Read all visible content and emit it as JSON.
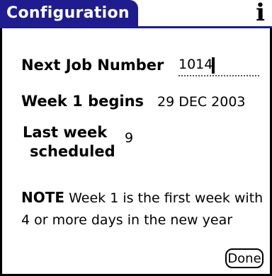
{
  "titlebar": {
    "title": "Configuration",
    "info_icon": "i"
  },
  "fields": {
    "next_job_label": "Next Job Number",
    "next_job_value": "1014",
    "week1_label": "Week 1 begins",
    "week1_value": "29 DEC 2003",
    "last_week_label_line1": "Last week",
    "last_week_label_line2": "scheduled",
    "last_week_value": "9"
  },
  "note": {
    "label": "NOTE",
    "text": "Week 1 is the first week with 4 or more days in the new year"
  },
  "buttons": {
    "done_label": "Done"
  }
}
